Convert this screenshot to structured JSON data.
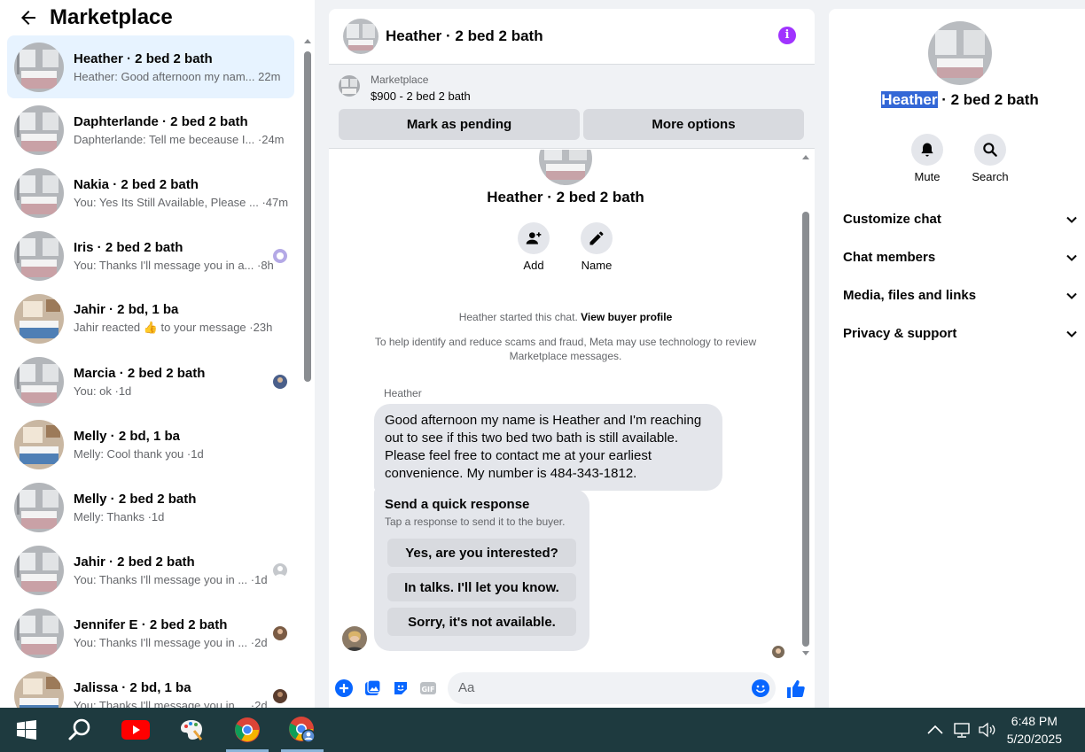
{
  "left": {
    "title": "Marketplace",
    "conversations": [
      {
        "name": "Heather · 2 bed 2 bath",
        "snippet": "Heather: Good afternoon my nam... 22m",
        "active": true,
        "photo": "bedroom-grey",
        "mini": null
      },
      {
        "name": "Daphterlande · 2 bed 2 bath",
        "snippet": "Daphterlande: Tell me beceause I... ·24m",
        "active": false,
        "photo": "bedroom-grey",
        "mini": null
      },
      {
        "name": "Nakia · 2 bed 2 bath",
        "snippet": "You: Yes Its Still Available, Please ... ·47m",
        "active": false,
        "photo": "bedroom-grey",
        "mini": null
      },
      {
        "name": "Iris · 2 bed 2 bath",
        "snippet": "You: Thanks I'll message you in a... ·8h",
        "active": false,
        "photo": "bedroom-grey",
        "mini": "avatar-lilac"
      },
      {
        "name": "Jahir · 2 bd, 1 ba",
        "snippet": "Jahir reacted 👍 to your message ·23h",
        "active": false,
        "photo": "bedroom-blue",
        "mini": null
      },
      {
        "name": "Marcia · 2 bed 2 bath",
        "snippet": "You: ok ·1d",
        "active": false,
        "photo": "bedroom-grey",
        "mini": "avatar-blue"
      },
      {
        "name": "Melly · 2 bd, 1 ba",
        "snippet": "Melly: Cool thank you ·1d",
        "active": false,
        "photo": "bedroom-blue",
        "mini": null
      },
      {
        "name": "Melly · 2 bed 2 bath",
        "snippet": "Melly: Thanks ·1d",
        "active": false,
        "photo": "bedroom-grey",
        "mini": null
      },
      {
        "name": "Jahir · 2 bed 2 bath",
        "snippet": "You: Thanks I'll message you in ... ·1d",
        "active": false,
        "photo": "bedroom-grey",
        "mini": "avatar-default"
      },
      {
        "name": "Jennifer E · 2 bed 2 bath",
        "snippet": "You: Thanks I'll message you in ... ·2d",
        "active": false,
        "photo": "bedroom-grey",
        "mini": "avatar-brown"
      },
      {
        "name": "Jalissa · 2 bd, 1 ba",
        "snippet": "You: Thanks I'll message you in ... ·2d",
        "active": false,
        "photo": "bedroom-blue",
        "mini": "avatar-dark"
      }
    ]
  },
  "chat": {
    "title": "Heather · 2 bed 2 bath",
    "marketplace_label": "Marketplace",
    "listing": "$900 - 2 bed 2 bath",
    "mark_pending": "Mark as pending",
    "more_options": "More options",
    "center_title": "Heather · 2 bed 2 bath",
    "add_label": "Add",
    "name_label": "Name",
    "started_text": "Heather started this chat.",
    "view_profile": "View buyer profile",
    "scam_notice_1": "To help identify and reduce scams and fraud, Meta may use technology to review",
    "scam_notice_2": "Marketplace messages.",
    "sender": "Heather",
    "message_lines": [
      "Good afternoon my name is Heather and I'm reaching",
      "out to see if this two bed two bath is still available.",
      "Please feel free to contact me at your earliest",
      "convenience. My number is 484-343-1812."
    ],
    "quick_title": "Send a quick response",
    "quick_sub": "Tap a response to send it to the buyer.",
    "quick_replies": [
      "Yes, are you interested?",
      "In talks. I'll let you know.",
      "Sorry, it's not available."
    ],
    "composer_placeholder": "Aa"
  },
  "right": {
    "title_highlight": "Heather",
    "title_rest": " · 2 bed 2 bath",
    "mute": "Mute",
    "search": "Search",
    "sections": [
      "Customize chat",
      "Chat members",
      "Media, files and links",
      "Privacy & support"
    ]
  },
  "taskbar": {
    "time": "6:48 PM",
    "date": "5/20/2025",
    "apps": [
      "windows-start",
      "search",
      "youtube",
      "paint",
      "chrome",
      "chrome-profile"
    ]
  },
  "colors": {
    "accent": "#0866ff",
    "info_purple": "#a033ff",
    "active_row": "#e7f3ff",
    "taskbar": "#1e3a3f"
  }
}
